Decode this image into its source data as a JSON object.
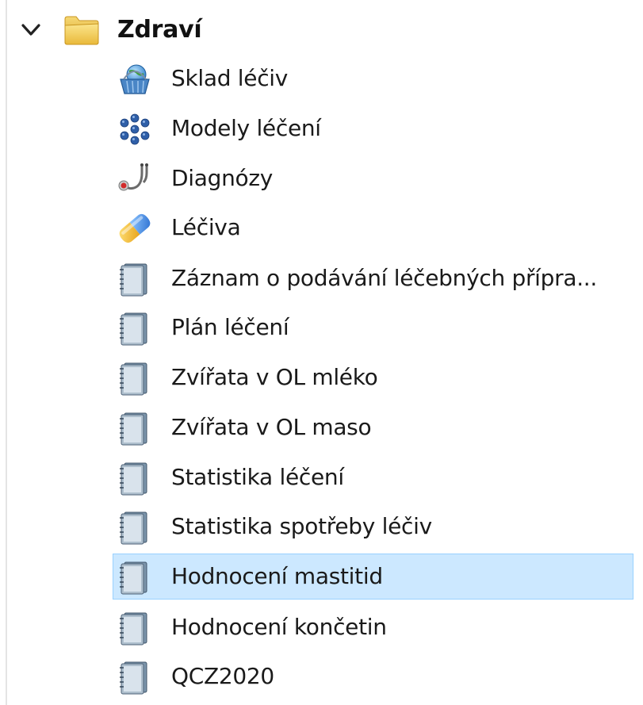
{
  "tree": {
    "folder": {
      "label": "Zdraví",
      "expanded": true,
      "icon": "folder-icon",
      "chevron": "chevron-down-icon"
    },
    "items": [
      {
        "label": "Sklad léčiv",
        "icon": "basket-globe-icon",
        "selected": false
      },
      {
        "label": "Modely léčení",
        "icon": "snowflake-icon",
        "selected": false
      },
      {
        "label": "Diagnózy",
        "icon": "stethoscope-icon",
        "selected": false
      },
      {
        "label": "Léčiva",
        "icon": "pill-icon",
        "selected": false
      },
      {
        "label": "Záznam o podávání léčebných přípra...",
        "icon": "report-book-icon",
        "selected": false
      },
      {
        "label": "Plán léčení",
        "icon": "report-book-icon",
        "selected": false
      },
      {
        "label": "Zvířata v OL mléko",
        "icon": "report-book-icon",
        "selected": false
      },
      {
        "label": "Zvířata v OL maso",
        "icon": "report-book-icon",
        "selected": false
      },
      {
        "label": "Statistika léčení",
        "icon": "report-book-icon",
        "selected": false
      },
      {
        "label": "Statistika spotřeby léčiv",
        "icon": "report-book-icon",
        "selected": false
      },
      {
        "label": "Hodnocení mastitid",
        "icon": "report-book-icon",
        "selected": true
      },
      {
        "label": "Hodnocení končetin",
        "icon": "report-book-icon",
        "selected": false
      },
      {
        "label": "QCZ2020",
        "icon": "report-book-icon",
        "selected": false
      }
    ]
  },
  "colors": {
    "selection_bg": "#cce8ff",
    "selection_border": "#99d1ff",
    "folder_yellow": "#f4d060",
    "book_blue": "#6a8fb0"
  }
}
